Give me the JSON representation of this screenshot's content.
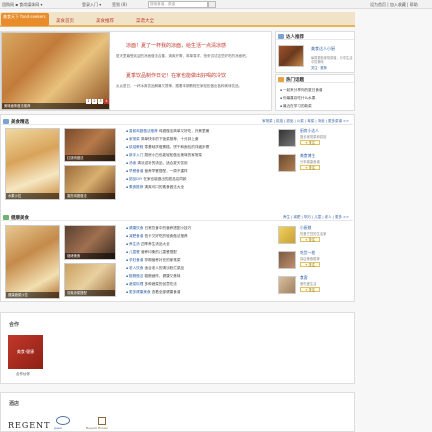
{
  "topbar": {
    "site_links": "团购网 ▪ 食尚媒体网 ▾",
    "login_label": "登录入门 ▾",
    "signin_label": "签到 (8)",
    "search_placeholder": "搜索食谱，菜谱",
    "right_links": "设为首页 | 加入收藏 | 帮助"
  },
  "nav": {
    "logo_text": "美食天下 food·seekers",
    "links": [
      "美食首页",
      "美食推荐",
      "菜谱大全"
    ]
  },
  "feature": {
    "image_caption": "美味面条做法推荐",
    "pages": [
      "1",
      "2",
      "3",
      "4"
    ],
    "headline1": "凉面！夏了一杯我的凉面，给生活一点清凉感",
    "text1": "夏天里最受欢迎的凉面做法合集，清爽开胃，简单易学，快来试试这些好吃的凉面吧。",
    "headline2": "夏季饮品制作日记！在家也能做出好喝的冷饮",
    "text2": "炎炎夏日，一杯冰爽饮品解暑又提神，跟着本期教程在家轻松做出各种美味饮品。"
  },
  "sidebar1": {
    "title": "达人推荐",
    "person_name": "美食达人小厨",
    "person_desc": "每周更新家常菜谱，分享生活中的美味",
    "person_desc2": "关注 · 推荐"
  },
  "sidebar2": {
    "title": "热门话题",
    "items": [
      "一起来分享你的夏日食谱",
      "你最喜欢吃什么水果",
      "最近在学习的新菜"
    ]
  },
  "section1": {
    "title": "美食精选",
    "links": "家常菜 | 烘焙 | 甜品 | 川菜 | 粤菜 | 汤羹 | 更多菜谱 >>",
    "photos": [
      "水果沙拉",
      "红烧肉做法",
      "家常炒饭",
      "香煎鸡翅做法"
    ],
    "items": [
      {
        "k": "香煎鸡翅做法推荐",
        "v": "鸡翅做法简单又好吃，外焦里嫩"
      },
      {
        "k": "家常菜",
        "v": "简单快手的下饭菜推荐，十分钟上桌"
      },
      {
        "k": "烘焙教程",
        "v": "零基础学做蛋糕、饼干和面包的详细步骤"
      },
      {
        "k": "新手入门",
        "v": "厨房小白也能轻松做出美味的家常菜"
      },
      {
        "k": "汤羹",
        "v": "清淡滋补的汤品，适合夏天饮用"
      },
      {
        "k": "早餐食谱",
        "v": "营养早餐搭配，一周不重样"
      },
      {
        "k": "甜品DIY",
        "v": "在家也能做出的甜品店同款"
      },
      {
        "k": "素食推荐",
        "v": "清爽可口的素食做法大全"
      }
    ]
  },
  "section2": {
    "title": "健康美食",
    "links": "养生 | 减肥 | 孕妇 | 儿童 | 老人 | 更多 >>",
    "photos": [
      "烧烤美食",
      "营养面条",
      "健康蔬菜沙拉",
      "清爽凉菜搭配"
    ],
    "items": [
      {
        "k": "健康饮食",
        "v": "日常饮食中的营养搭配小技巧"
      },
      {
        "k": "减肥食谱",
        "v": "低卡又好吃的轻食做法推荐"
      },
      {
        "k": "养生汤",
        "v": "四季养生汤品大全"
      },
      {
        "k": "儿童餐",
        "v": "营养均衡的儿童餐搭配"
      },
      {
        "k": "孕妇食谱",
        "v": "孕期营养补充的家常菜"
      },
      {
        "k": "老人饮食",
        "v": "适合老人的清淡软烂菜品"
      },
      {
        "k": "粗粮做法",
        "v": "粗粮细作，健康又美味"
      },
      {
        "k": "蔬菜料理",
        "v": "多种蔬菜的创意吃法"
      },
      {
        "k": "更多健康美食",
        "v": "查看全部健康食谱"
      }
    ]
  },
  "people": [
    {
      "name": "厨房小达人",
      "desc": "擅长家常菜和烘焙",
      "btn": "+ 关注"
    },
    {
      "name": "美食博主",
      "desc": "分享健康食谱",
      "btn": "+ 关注"
    },
    {
      "name": "小厨娘",
      "desc": "热爱烹饪的生活家",
      "btn": "+ 关注"
    },
    {
      "name": "吃货一枚",
      "desc": "探店美食推荐",
      "btn": "+ 关注"
    },
    {
      "name": "面点师",
      "desc": "面食制作达人",
      "btn": "+ 关注"
    },
    {
      "name": "食客",
      "desc": "爱吃爱生活",
      "btn": "+ 关注"
    }
  ],
  "partners": {
    "title": "合作",
    "card_text": "美食·健康",
    "card_label": "合作伙伴"
  },
  "hotels": {
    "title": "酒店",
    "logos": [
      "REGENT",
      "Jewel",
      "Regent Hotels"
    ]
  }
}
